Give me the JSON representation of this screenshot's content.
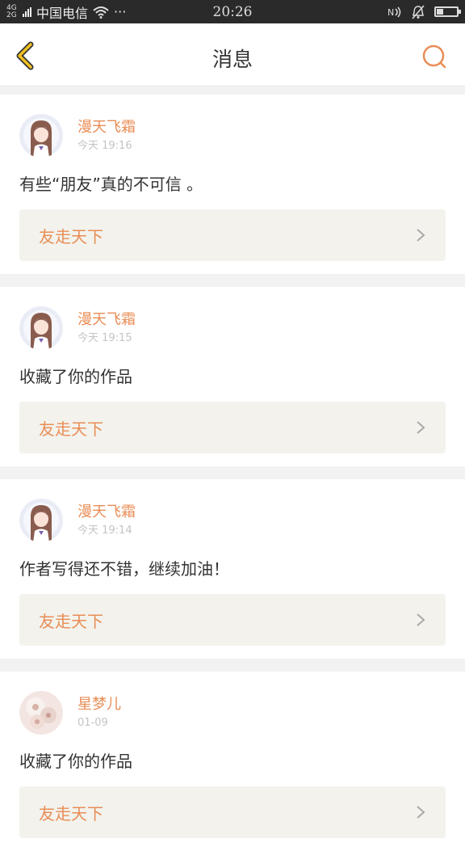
{
  "status_bar": {
    "network_type": "4G\n2G",
    "carrier": "中国电信",
    "more": "···",
    "time": "20:26",
    "battery_level": 0.3
  },
  "header": {
    "title": "消息"
  },
  "icons": {
    "back": "chevron-left-icon",
    "search": "search-icon",
    "forward": "chevron-right-icon"
  },
  "colors": {
    "accent": "#e98d56",
    "back_icon": "#f0c020",
    "ref_bg": "#f3f2ec"
  },
  "messages": [
    {
      "name": "漫天飞霜",
      "time": "今天 19:16",
      "text": "有些“朋友”真的不可信 。",
      "ref_title": "友走天下",
      "avatar": "anime-girl"
    },
    {
      "name": "漫天飞霜",
      "time": "今天 19:15",
      "text": "收藏了你的作品",
      "ref_title": "友走天下",
      "avatar": "anime-girl"
    },
    {
      "name": "漫天飞霜",
      "time": "今天 19:14",
      "text": "作者写得还不错，继续加油！",
      "ref_title": "友走天下",
      "avatar": "anime-girl"
    },
    {
      "name": "星梦儿",
      "time": "01-09",
      "text": "收藏了你的作品",
      "ref_title": "友走天下",
      "avatar": "floral"
    }
  ]
}
